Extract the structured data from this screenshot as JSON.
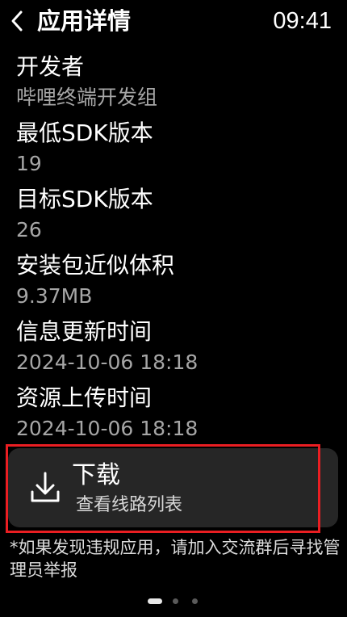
{
  "header": {
    "title": "应用详情",
    "time": "09:41",
    "back_icon": "chevron-left-icon"
  },
  "info": [
    {
      "label": "开发者",
      "value": "哔哩终端开发组"
    },
    {
      "label": "最低SDK版本",
      "value": "19"
    },
    {
      "label": "目标SDK版本",
      "value": "26"
    },
    {
      "label": "安装包近似体积",
      "value": "9.37MB"
    },
    {
      "label": "信息更新时间",
      "value": "2024-10-06 18:18"
    },
    {
      "label": "资源上传时间",
      "value": "2024-10-06 18:18"
    }
  ],
  "download": {
    "title": "下载",
    "subtitle": "查看线路列表",
    "icon": "download-icon",
    "highlight_color": "#ea1e22"
  },
  "notice": "*如果发现违规应用，请加入交流群后寻找管理员举报",
  "pager": {
    "pages": 3,
    "current": 1
  },
  "colors": {
    "background": "#000000",
    "card": "#262626",
    "secondary_text": "#a6a6a6"
  }
}
